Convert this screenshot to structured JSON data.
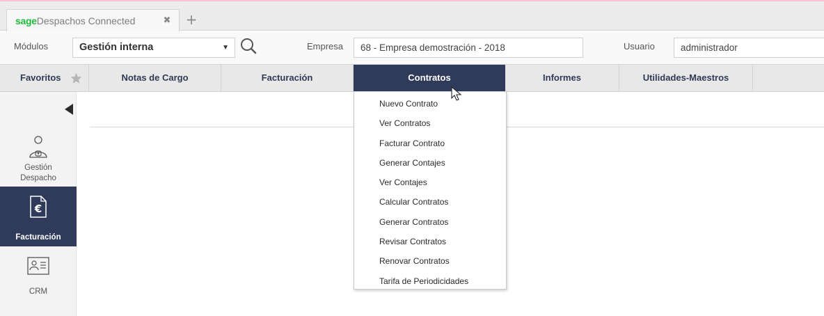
{
  "app_tab": {
    "brand": "sage",
    "title": "Despachos Connected",
    "close_icon": "close-icon",
    "new_tab_icon": "plus-icon"
  },
  "toolbar": {
    "modulos_label": "Módulos",
    "modulos_value": "Gestión interna",
    "search_icon": "search-icon",
    "empresa_label": "Empresa",
    "empresa_value": "68 - Empresa demostración - 2018",
    "usuario_label": "Usuario",
    "usuario_value": "administrador"
  },
  "nav": {
    "favoritos": "Favoritos",
    "items": [
      "Notas de Cargo",
      "Facturación",
      "Contratos",
      "Informes",
      "Utilidades-Maestros"
    ],
    "active": "Contratos"
  },
  "sidebar": {
    "items": [
      {
        "label1": "Gestión",
        "label2": "Despacho",
        "icon": "user-id-icon"
      },
      {
        "label": "Facturación",
        "icon": "invoice-euro-icon",
        "active": true
      },
      {
        "label": "CRM",
        "icon": "contact-card-icon"
      }
    ]
  },
  "contratos_menu": {
    "items": [
      "Nuevo Contrato",
      "Ver Contratos",
      "Facturar Contrato",
      "Generar Contajes",
      "Ver Contajes",
      "Calcular Contratos",
      "Generar Contratos",
      "Revisar Contratos",
      "Renovar Contratos",
      "Tarifa de Periodicidades"
    ]
  },
  "colors": {
    "accent_navy": "#303b5c",
    "brand_green": "#1fba3c"
  }
}
